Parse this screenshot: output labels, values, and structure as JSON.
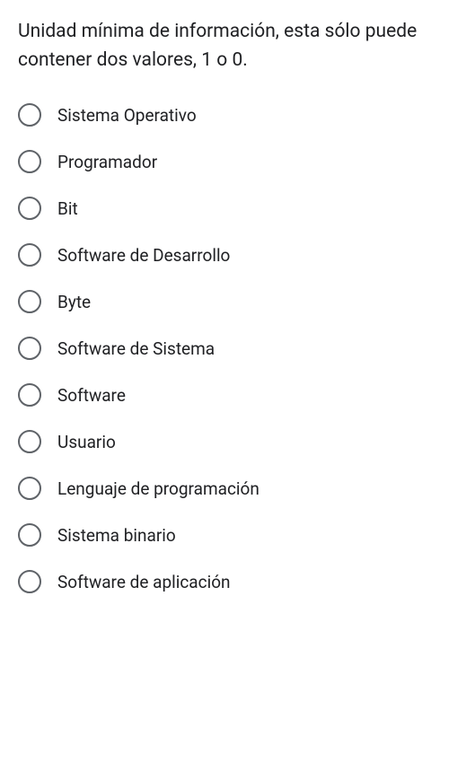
{
  "question": "Unidad mínima de información, esta sólo puede contener dos valores, 1 o 0.",
  "options": [
    {
      "label": "Sistema Operativo"
    },
    {
      "label": "Programador"
    },
    {
      "label": "Bit"
    },
    {
      "label": "Software de Desarrollo"
    },
    {
      "label": "Byte"
    },
    {
      "label": "Software de Sistema"
    },
    {
      "label": "Software"
    },
    {
      "label": "Usuario"
    },
    {
      "label": "Lenguaje de programación"
    },
    {
      "label": "Sistema binario"
    },
    {
      "label": "Software de aplicación"
    }
  ]
}
